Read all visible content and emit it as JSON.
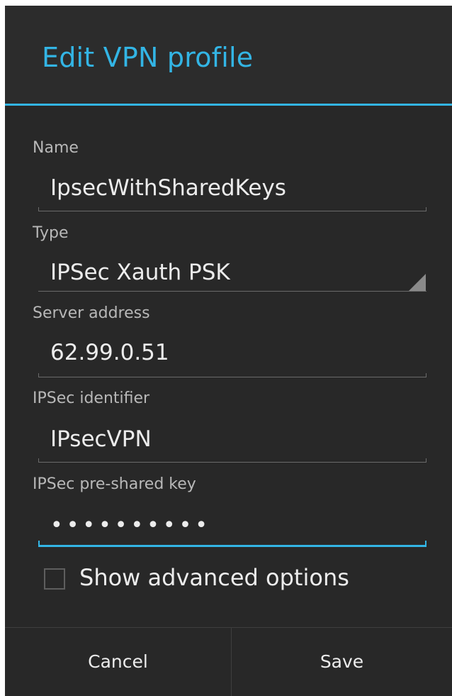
{
  "dialog": {
    "title": "Edit VPN profile"
  },
  "fields": {
    "name": {
      "label": "Name",
      "value": "IpsecWithSharedKeys"
    },
    "type": {
      "label": "Type",
      "value": "IPSec Xauth PSK"
    },
    "server": {
      "label": "Server address",
      "value": "62.99.0.51"
    },
    "identifier": {
      "label": "IPSec identifier",
      "value": "IPsecVPN"
    },
    "psk": {
      "label": "IPSec pre-shared key",
      "masked_value": "••••••••••"
    }
  },
  "advanced": {
    "label": "Show advanced options",
    "checked": false
  },
  "buttons": {
    "cancel": "Cancel",
    "save": "Save"
  },
  "colors": {
    "accent": "#33b5e5",
    "background": "#282828",
    "text": "#ececec",
    "label": "#b8b8b8"
  }
}
